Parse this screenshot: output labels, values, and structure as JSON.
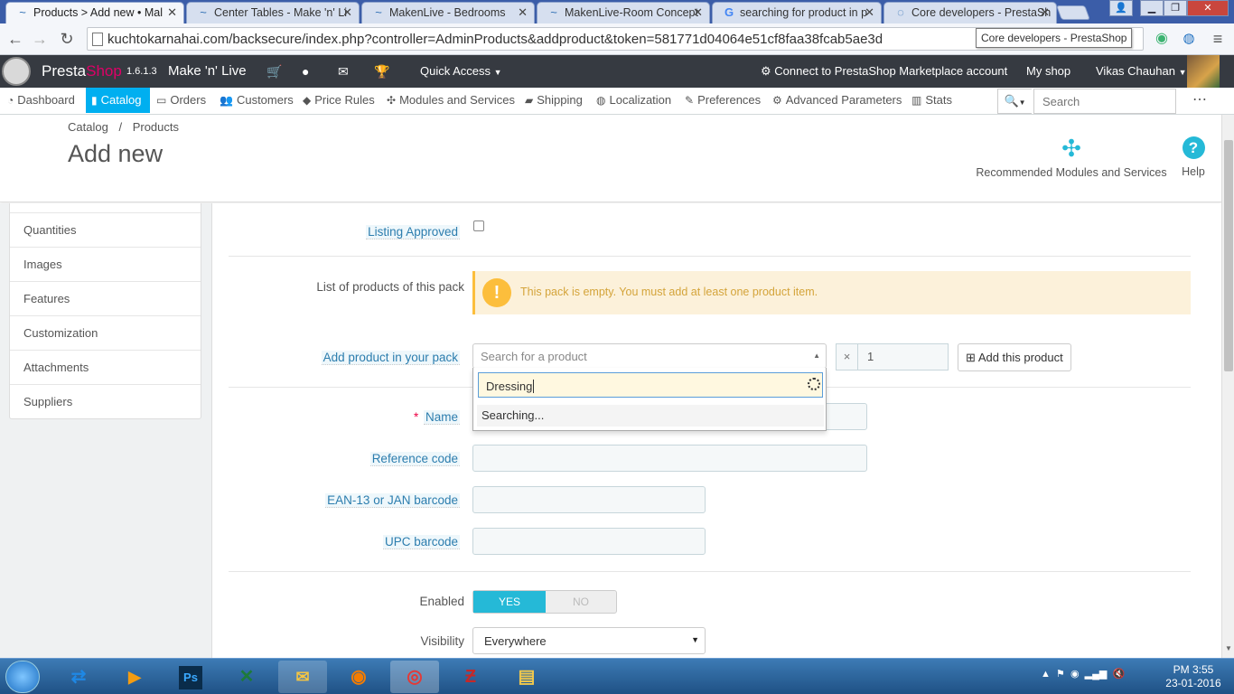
{
  "browser": {
    "tabs": [
      {
        "title": "Products > Add new • Mal",
        "active": true
      },
      {
        "title": "Center Tables - Make 'n' Li"
      },
      {
        "title": "MakenLive - Bedrooms"
      },
      {
        "title": "MakenLive-Room Concept"
      },
      {
        "title": "searching for product in p"
      },
      {
        "title": "Core developers - PrestaSh"
      }
    ],
    "url": "kuchtokarnahai.com/backsecure/index.php?controller=AdminProducts&addproduct&token=581771d04064e51cf8faa38fcab5ae3d",
    "tooltip": "Core developers - PrestaShop"
  },
  "header": {
    "brand_presta": "Presta",
    "brand_shop": "Shop",
    "version": "1.6.1.3",
    "shop_name": "Make 'n' Live",
    "quick_access": "Quick Access",
    "connect": "Connect to PrestaShop Marketplace account",
    "my_shop": "My shop",
    "user": "Vikas Chauhan"
  },
  "nav": {
    "items": [
      "Dashboard",
      "Catalog",
      "Orders",
      "Customers",
      "Price Rules",
      "Modules and Services",
      "Shipping",
      "Localization",
      "Preferences",
      "Advanced Parameters",
      "Stats"
    ],
    "search_placeholder": "Search"
  },
  "toolbar": {
    "breadcrumb_1": "Catalog",
    "breadcrumb_sep": "/",
    "breadcrumb_2": "Products",
    "page_title": "Add new",
    "recommended": "Recommended Modules and Services",
    "help": "Help"
  },
  "sidebar": {
    "items": [
      "Quantities",
      "Images",
      "Features",
      "Customization",
      "Attachments",
      "Suppliers"
    ]
  },
  "form": {
    "listing_approved": "Listing Approved",
    "pack_list_label": "List of products of this pack",
    "pack_empty_msg": "This pack is empty. You must add at least one product item.",
    "add_product_label": "Add product in your pack",
    "search_placeholder": "Search for a product",
    "search_value": "Dressing",
    "searching": "Searching...",
    "qty_x": "×",
    "qty_value": "1",
    "add_button": "Add this product",
    "required_star": "*",
    "name": "Name",
    "reference": "Reference code",
    "ean": "EAN-13 or JAN barcode",
    "upc": "UPC barcode",
    "enabled": "Enabled",
    "yes": "YES",
    "no": "NO",
    "visibility": "Visibility",
    "visibility_value": "Everywhere"
  },
  "taskbar": {
    "apps": [
      "teamviewer-icon",
      "media-icon",
      "Ps",
      "excel-icon",
      "outlook-icon",
      "firefox-icon",
      "chrome-icon",
      "filezilla-icon",
      "explorer-icon"
    ],
    "time": "PM 3:55",
    "date": "23-01-2016"
  },
  "colors": {
    "accent": "#00aff0",
    "header_bg": "#363a41",
    "warning_bg": "#fcf1da",
    "warning_icon": "#fcbe3c"
  }
}
